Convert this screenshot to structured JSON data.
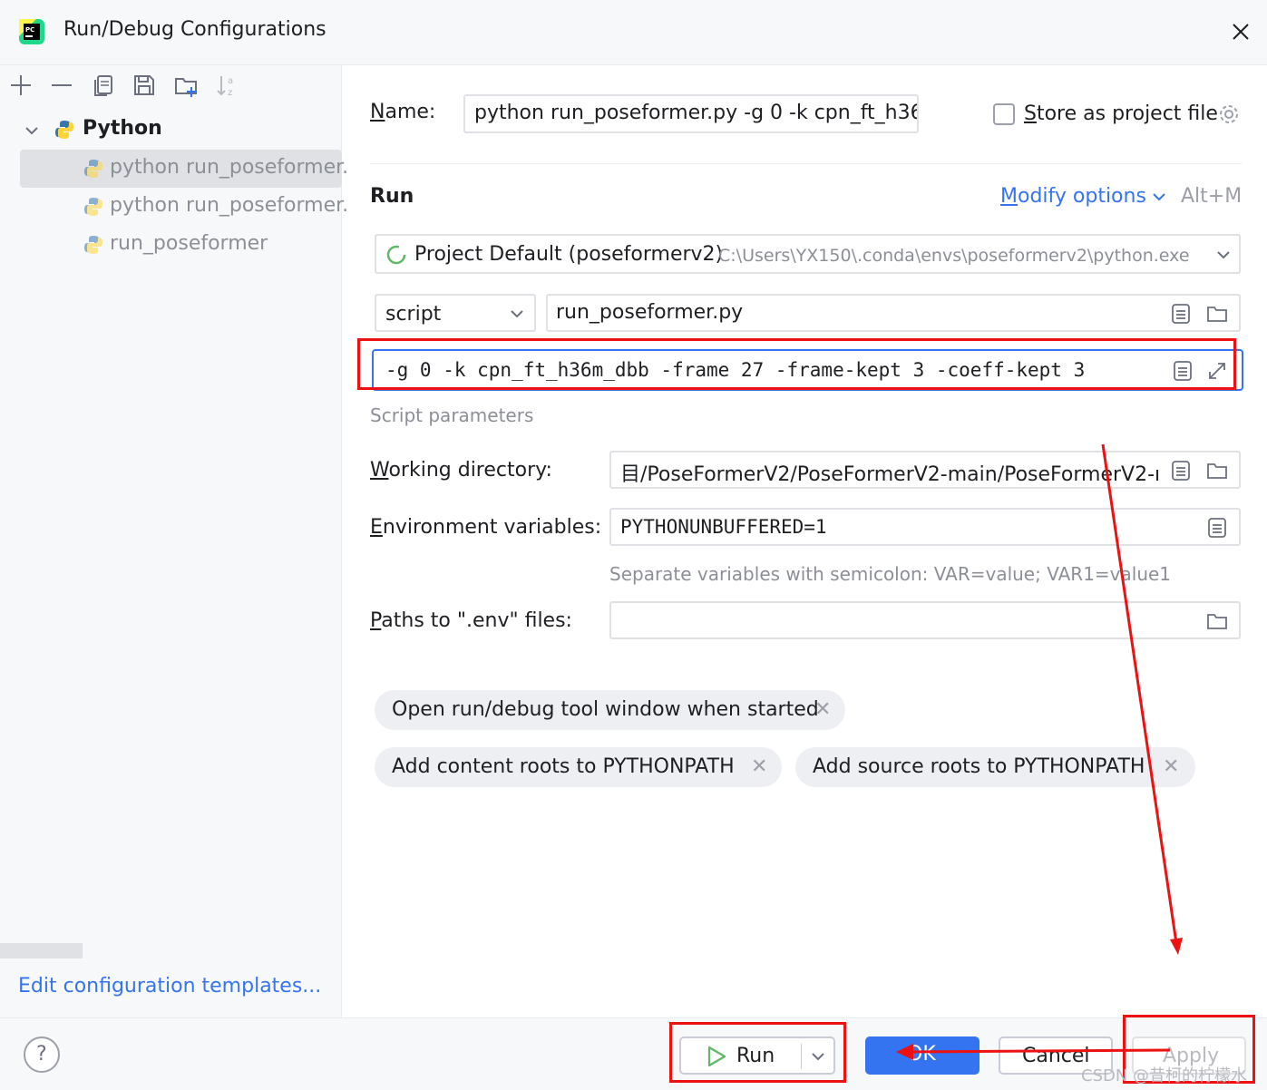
{
  "window": {
    "title": "Run/Debug Configurations",
    "close_glyph": "✕"
  },
  "toolbar": {
    "icons": [
      "add-icon",
      "remove-icon",
      "copy-icon",
      "save-icon",
      "new-folder-icon",
      "sort-icon"
    ]
  },
  "tree": {
    "root_label": "Python",
    "items": [
      {
        "label": "python run_poseformer."
      },
      {
        "label": "python run_poseformer."
      },
      {
        "label": "run_poseformer"
      }
    ]
  },
  "edit_templates_link": "Edit configuration templates...",
  "form": {
    "name_label": "Name:",
    "name_value": "python run_poseformer.py -g 0 -k cpn_ft_h36",
    "store_label": "Store as project file",
    "run_section": "Run",
    "modify_options": "Modify options",
    "modify_shortcut": "Alt+M",
    "interpreter_name": "Project Default (poseformerv2)",
    "interpreter_path": "C:\\Users\\YX150\\.conda\\envs\\poseformerv2\\python.exe",
    "script_type": "script",
    "script_path": "run_poseformer.py",
    "script_params": "-g 0 -k cpn_ft_h36m_dbb -frame 27 -frame-kept 3 -coeff-kept 3",
    "script_params_hint": "Script parameters",
    "workdir_label": "Working directory:",
    "workdir_value": "目/PoseFormerV2/PoseFormerV2-main/PoseFormerV2-ı",
    "env_label": "Environment variables:",
    "env_value": "PYTHONUNBUFFERED=1",
    "env_hint": "Separate variables with semicolon: VAR=value; VAR1=value1",
    "dotenv_label": "Paths to \".env\" files:",
    "dotenv_value": "",
    "chips": [
      "Open run/debug tool window when started",
      "Add content roots to PYTHONPATH",
      "Add source roots to PYTHONPATH"
    ]
  },
  "buttons": {
    "help": "?",
    "run": "Run",
    "ok": "OK",
    "cancel": "Cancel",
    "apply": "Apply"
  },
  "watermark": "CSDN @昔柯的柠檬水",
  "colors": {
    "accent": "#3574f0",
    "annotation_red": "#ee1111",
    "selection": "#dfe1e5"
  }
}
